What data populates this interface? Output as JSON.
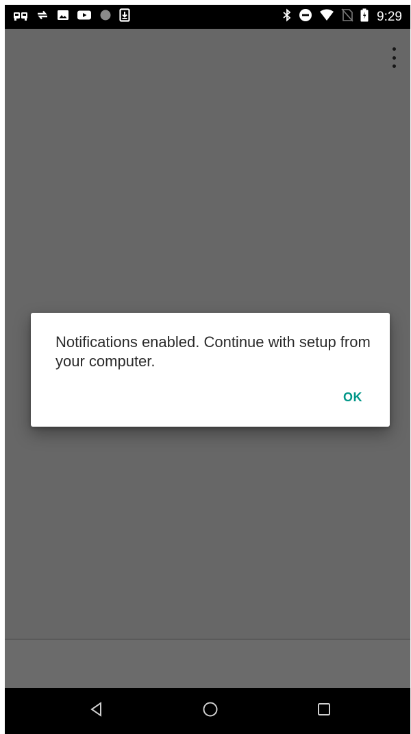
{
  "status_bar": {
    "time": "9:29",
    "left_icons": [
      "cars-icon",
      "sync-icon",
      "image-icon",
      "youtube-icon",
      "circle-icon",
      "download-icon"
    ],
    "right_icons": [
      "bluetooth-icon",
      "do-not-disturb-icon",
      "wifi-icon",
      "no-sim-icon",
      "battery-icon"
    ]
  },
  "toolbar": {
    "overflow_icon": "more-vert-icon"
  },
  "dialog": {
    "message": "Notifications enabled. Continue with setup from your computer.",
    "ok_label": "OK"
  },
  "nav_bar": {
    "icons": [
      "back-icon",
      "home-icon",
      "recents-icon"
    ]
  },
  "colors": {
    "accent": "#009688",
    "scrim": "#676767",
    "bar_black": "#000000",
    "dialog_bg": "#ffffff"
  }
}
